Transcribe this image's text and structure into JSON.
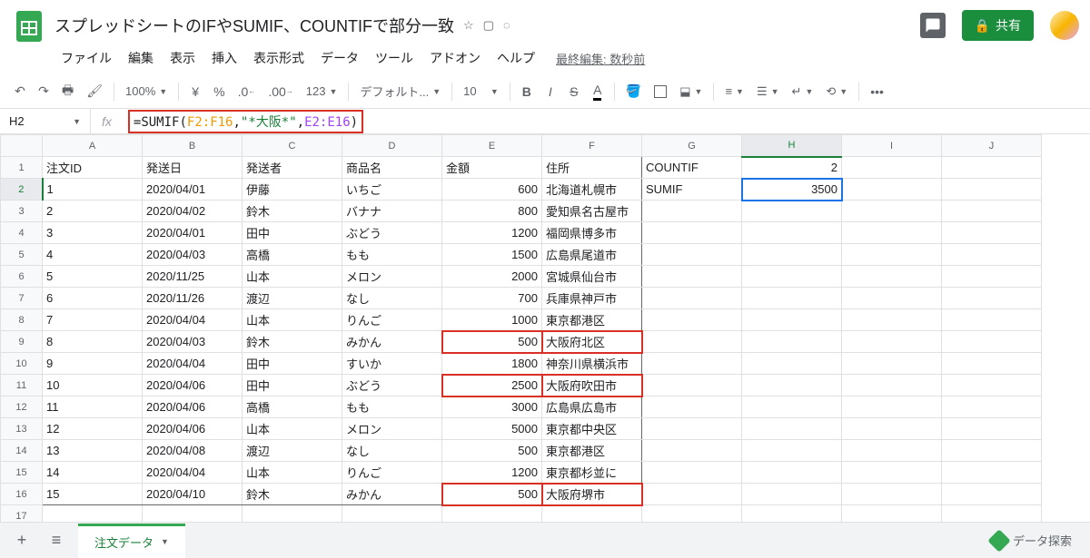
{
  "doc": {
    "title": "スプレッドシートのIFやSUMIF、COUNTIFで部分一致",
    "last_edit": "最終編集: 数秒前",
    "share_label": "共有"
  },
  "menus": [
    "ファイル",
    "編集",
    "表示",
    "挿入",
    "表示形式",
    "データ",
    "ツール",
    "アドオン",
    "ヘルプ"
  ],
  "toolbar": {
    "zoom": "100%",
    "currency": "¥",
    "percent": "%",
    "dec_dec": ".0",
    "inc_dec": ".00",
    "more_fmt": "123",
    "font": "デフォルト...",
    "font_size": "10",
    "more": "•••"
  },
  "formula_bar": {
    "name_box": "H2",
    "fx": "fx",
    "parts": {
      "eq": "=SUMIF(",
      "range1": "F2:F16",
      "comma1": ",",
      "str": "\"*大阪*\"",
      "comma2": ",",
      "range2": "E2:E16",
      "close": ")"
    }
  },
  "columns": [
    "A",
    "B",
    "C",
    "D",
    "E",
    "F",
    "G",
    "H",
    "I",
    "J"
  ],
  "headers": {
    "A": "注文ID",
    "B": "発送日",
    "C": "発送者",
    "D": "商品名",
    "E": "金額",
    "F": "住所",
    "G": "COUNTIF",
    "H": "2"
  },
  "extra_row2": {
    "G": "SUMIF",
    "H": "3500"
  },
  "rows": [
    {
      "id": "1",
      "date": "2020/04/01",
      "sender": "伊藤",
      "item": "いちご",
      "amt": "600",
      "addr": "北海道札幌市",
      "hilite": false
    },
    {
      "id": "2",
      "date": "2020/04/02",
      "sender": "鈴木",
      "item": "バナナ",
      "amt": "800",
      "addr": "愛知県名古屋市",
      "hilite": false
    },
    {
      "id": "3",
      "date": "2020/04/01",
      "sender": "田中",
      "item": "ぶどう",
      "amt": "1200",
      "addr": "福岡県博多市",
      "hilite": false
    },
    {
      "id": "4",
      "date": "2020/04/03",
      "sender": "高橋",
      "item": "もも",
      "amt": "1500",
      "addr": "広島県尾道市",
      "hilite": false
    },
    {
      "id": "5",
      "date": "2020/11/25",
      "sender": "山本",
      "item": "メロン",
      "amt": "2000",
      "addr": "宮城県仙台市",
      "hilite": false
    },
    {
      "id": "6",
      "date": "2020/11/26",
      "sender": "渡辺",
      "item": "なし",
      "amt": "700",
      "addr": "兵庫県神戸市",
      "hilite": false
    },
    {
      "id": "7",
      "date": "2020/04/04",
      "sender": "山本",
      "item": "りんご",
      "amt": "1000",
      "addr": "東京都港区",
      "hilite": false
    },
    {
      "id": "8",
      "date": "2020/04/03",
      "sender": "鈴木",
      "item": "みかん",
      "amt": "500",
      "addr": "大阪府北区",
      "hilite": true
    },
    {
      "id": "9",
      "date": "2020/04/04",
      "sender": "田中",
      "item": "すいか",
      "amt": "1800",
      "addr": "神奈川県横浜市",
      "hilite": false
    },
    {
      "id": "10",
      "date": "2020/04/06",
      "sender": "田中",
      "item": "ぶどう",
      "amt": "2500",
      "addr": "大阪府吹田市",
      "hilite": true
    },
    {
      "id": "11",
      "date": "2020/04/06",
      "sender": "高橋",
      "item": "もも",
      "amt": "3000",
      "addr": "広島県広島市",
      "hilite": false
    },
    {
      "id": "12",
      "date": "2020/04/06",
      "sender": "山本",
      "item": "メロン",
      "amt": "5000",
      "addr": "東京都中央区",
      "hilite": false
    },
    {
      "id": "13",
      "date": "2020/04/08",
      "sender": "渡辺",
      "item": "なし",
      "amt": "500",
      "addr": "東京都港区",
      "hilite": false
    },
    {
      "id": "14",
      "date": "2020/04/04",
      "sender": "山本",
      "item": "りんご",
      "amt": "1200",
      "addr": "東京都杉並に",
      "hilite": false
    },
    {
      "id": "15",
      "date": "2020/04/10",
      "sender": "鈴木",
      "item": "みかん",
      "amt": "500",
      "addr": "大阪府堺市",
      "hilite": true
    }
  ],
  "sheet_tab": "注文データ",
  "explore_label": "データ探索"
}
